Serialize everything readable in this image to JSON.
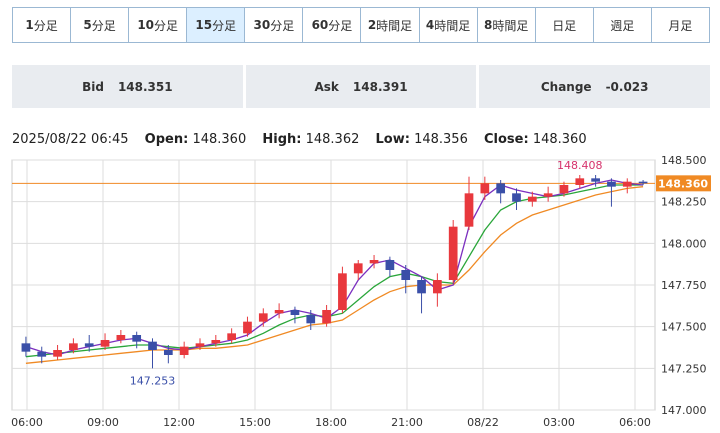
{
  "timeframes": [
    {
      "num": "1",
      "unit": "分足",
      "active": false
    },
    {
      "num": "5",
      "unit": "分足",
      "active": false
    },
    {
      "num": "10",
      "unit": "分足",
      "active": false
    },
    {
      "num": "15",
      "unit": "分足",
      "active": true
    },
    {
      "num": "30",
      "unit": "分足",
      "active": false
    },
    {
      "num": "60",
      "unit": "分足",
      "active": false
    },
    {
      "num": "2",
      "unit": "時間足",
      "active": false
    },
    {
      "num": "4",
      "unit": "時間足",
      "active": false
    },
    {
      "num": "8",
      "unit": "時間足",
      "active": false
    },
    {
      "num": "",
      "unit": "日足",
      "active": false
    },
    {
      "num": "",
      "unit": "週足",
      "active": false
    },
    {
      "num": "",
      "unit": "月足",
      "active": false
    }
  ],
  "quotes": {
    "bid_label": "Bid",
    "bid_value": "148.351",
    "ask_label": "Ask",
    "ask_value": "148.391",
    "change_label": "Change",
    "change_value": "-0.023"
  },
  "ohlc": {
    "datetime": "2025/08/22 06:45",
    "open_label": "Open:",
    "open": "148.360",
    "high_label": "High:",
    "high": "148.362",
    "low_label": "Low:",
    "low": "148.356",
    "close_label": "Close:",
    "close": "148.360"
  },
  "colors": {
    "up": "#e8383d",
    "down": "#3a4fa8",
    "ma_short": "#7b2fbf",
    "ma_mid": "#2aa63a",
    "ma_long": "#f08a24",
    "current_price": "#f08a24",
    "grid": "#dddddd",
    "high_label": "#d6336c",
    "low_label": "#3a4fa8"
  },
  "chart_data": {
    "type": "candlestick",
    "x_ticks": [
      "06:00",
      "09:00",
      "12:00",
      "15:00",
      "18:00",
      "21:00",
      "08/22",
      "03:00",
      "06:00"
    ],
    "y_ticks": [
      "148.500",
      "148.250",
      "148.000",
      "147.750",
      "147.500",
      "147.250",
      "147.000"
    ],
    "ylim": [
      147.0,
      148.5
    ],
    "current_price": "148.360",
    "high_annotation": "148.408",
    "low_annotation": "147.253",
    "ma_short": [
      147.38,
      147.35,
      147.33,
      147.36,
      147.38,
      147.4,
      147.42,
      147.43,
      147.4,
      147.37,
      147.36,
      147.38,
      147.4,
      147.42,
      147.45,
      147.52,
      147.58,
      147.6,
      147.58,
      147.55,
      147.62,
      147.78,
      147.88,
      147.9,
      147.85,
      147.8,
      147.72,
      147.75,
      148.1,
      148.28,
      148.35,
      148.32,
      148.3,
      148.28,
      148.3,
      148.33,
      148.36,
      148.38,
      148.36,
      148.35
    ],
    "ma_mid": [
      147.32,
      147.33,
      147.34,
      147.35,
      147.36,
      147.37,
      147.38,
      147.39,
      147.39,
      147.38,
      147.37,
      147.38,
      147.39,
      147.4,
      147.42,
      147.46,
      147.51,
      147.55,
      147.57,
      147.56,
      147.58,
      147.66,
      147.74,
      147.8,
      147.82,
      147.8,
      147.77,
      147.76,
      147.92,
      148.08,
      148.2,
      148.25,
      148.27,
      148.28,
      148.29,
      148.31,
      148.33,
      148.35,
      148.35,
      148.35
    ],
    "ma_long": [
      147.28,
      147.29,
      147.3,
      147.31,
      147.32,
      147.33,
      147.34,
      147.35,
      147.36,
      147.36,
      147.36,
      147.37,
      147.37,
      147.38,
      147.39,
      147.42,
      147.45,
      147.48,
      147.51,
      147.52,
      147.54,
      147.6,
      147.66,
      147.71,
      147.74,
      147.75,
      147.75,
      147.75,
      147.84,
      147.95,
      148.05,
      148.12,
      148.17,
      148.2,
      148.23,
      148.26,
      148.29,
      148.31,
      148.33,
      148.34
    ],
    "candles": [
      [
        147.4,
        147.35,
        147.44,
        147.32
      ],
      [
        147.35,
        147.32,
        147.38,
        147.28
      ],
      [
        147.32,
        147.36,
        147.39,
        147.3
      ],
      [
        147.36,
        147.4,
        147.43,
        147.34
      ],
      [
        147.4,
        147.38,
        147.45,
        147.35
      ],
      [
        147.38,
        147.42,
        147.46,
        147.36
      ],
      [
        147.42,
        147.45,
        147.48,
        147.4
      ],
      [
        147.45,
        147.41,
        147.47,
        147.37
      ],
      [
        147.41,
        147.36,
        147.43,
        147.25
      ],
      [
        147.36,
        147.33,
        147.39,
        147.28
      ],
      [
        147.33,
        147.38,
        147.41,
        147.31
      ],
      [
        147.38,
        147.4,
        147.43,
        147.36
      ],
      [
        147.4,
        147.42,
        147.45,
        147.38
      ],
      [
        147.42,
        147.46,
        147.49,
        147.4
      ],
      [
        147.46,
        147.53,
        147.56,
        147.44
      ],
      [
        147.53,
        147.58,
        147.61,
        147.5
      ],
      [
        147.58,
        147.6,
        147.64,
        147.55
      ],
      [
        147.6,
        147.57,
        147.62,
        147.52
      ],
      [
        147.57,
        147.52,
        147.6,
        147.48
      ],
      [
        147.52,
        147.6,
        147.63,
        147.5
      ],
      [
        147.6,
        147.82,
        147.86,
        147.58
      ],
      [
        147.82,
        147.88,
        147.9,
        147.78
      ],
      [
        147.88,
        147.9,
        147.93,
        147.85
      ],
      [
        147.9,
        147.84,
        147.92,
        147.8
      ],
      [
        147.84,
        147.78,
        147.87,
        147.7
      ],
      [
        147.78,
        147.7,
        147.8,
        147.58
      ],
      [
        147.7,
        147.78,
        147.82,
        147.62
      ],
      [
        147.78,
        148.1,
        148.14,
        147.76
      ],
      [
        148.1,
        148.3,
        148.4,
        148.08
      ],
      [
        148.3,
        148.36,
        148.4,
        148.26
      ],
      [
        148.36,
        148.3,
        148.38,
        148.24
      ],
      [
        148.3,
        148.25,
        148.33,
        148.2
      ],
      [
        148.25,
        148.28,
        148.31,
        148.22
      ],
      [
        148.28,
        148.3,
        148.34,
        148.25
      ],
      [
        148.3,
        148.35,
        148.37,
        148.28
      ],
      [
        148.35,
        148.39,
        148.41,
        148.33
      ],
      [
        148.39,
        148.37,
        148.41,
        148.34
      ],
      [
        148.37,
        148.34,
        148.39,
        148.22
      ],
      [
        148.34,
        148.37,
        148.39,
        148.3
      ],
      [
        148.37,
        148.36,
        148.38,
        148.35
      ]
    ]
  }
}
